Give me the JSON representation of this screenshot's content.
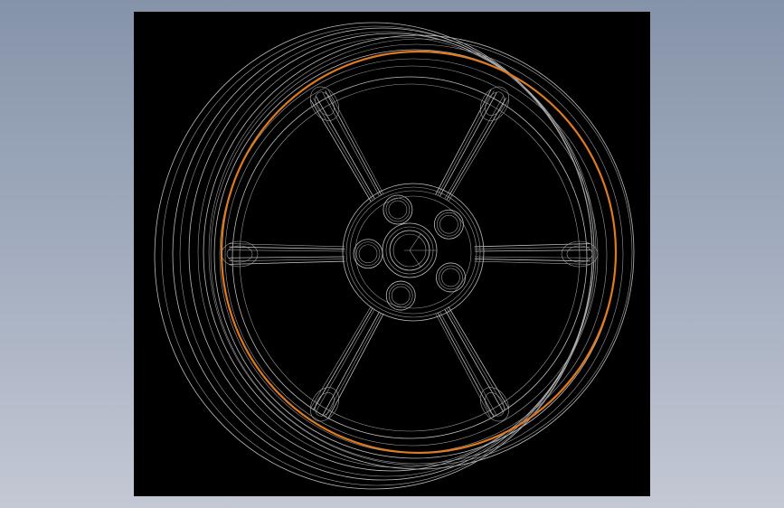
{
  "background": {
    "gradient_top": "#8593a9",
    "gradient_bottom": "#c3c8d4"
  },
  "viewport": {
    "background_color": "#000000",
    "wire_color": "#bdbdbd",
    "highlight_color": "#e07a1f",
    "model": "wheel-rim-wireframe",
    "spoke_count": 6,
    "lug_hole_count": 5
  }
}
